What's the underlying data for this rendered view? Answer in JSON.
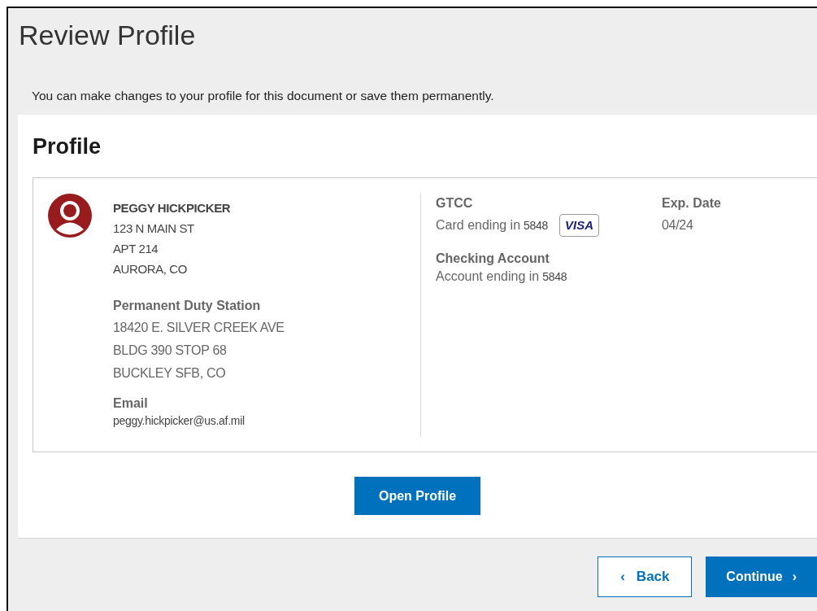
{
  "page": {
    "title": "Review Profile",
    "intro": "You can make changes to your profile for this document or save them permanently."
  },
  "profile": {
    "heading": "Profile",
    "name": "PEGGY HICKPICKER",
    "address": [
      "123 N MAIN ST",
      "APT 214",
      "AURORA, CO"
    ],
    "duty_station": {
      "label": "Permanent Duty Station",
      "lines": [
        "18420 E. SILVER CREEK AVE",
        "BLDG 390 STOP 68",
        "BUCKLEY SFB, CO"
      ]
    },
    "email": {
      "label": "Email",
      "value": "peggy.hickpicker@us.af.mil"
    },
    "gtcc": {
      "label": "GTCC",
      "text": "Card ending in",
      "number": "5848",
      "brand": "VISA"
    },
    "exp_date": {
      "label": "Exp. Date",
      "value": "04/24"
    },
    "checking": {
      "label": "Checking Account",
      "text": "Account ending in",
      "number": "5848"
    },
    "open_button": "Open Profile"
  },
  "footer": {
    "back": {
      "label": "Back",
      "icon": "‹"
    },
    "continue": {
      "label": "Continue",
      "icon": "›"
    }
  }
}
